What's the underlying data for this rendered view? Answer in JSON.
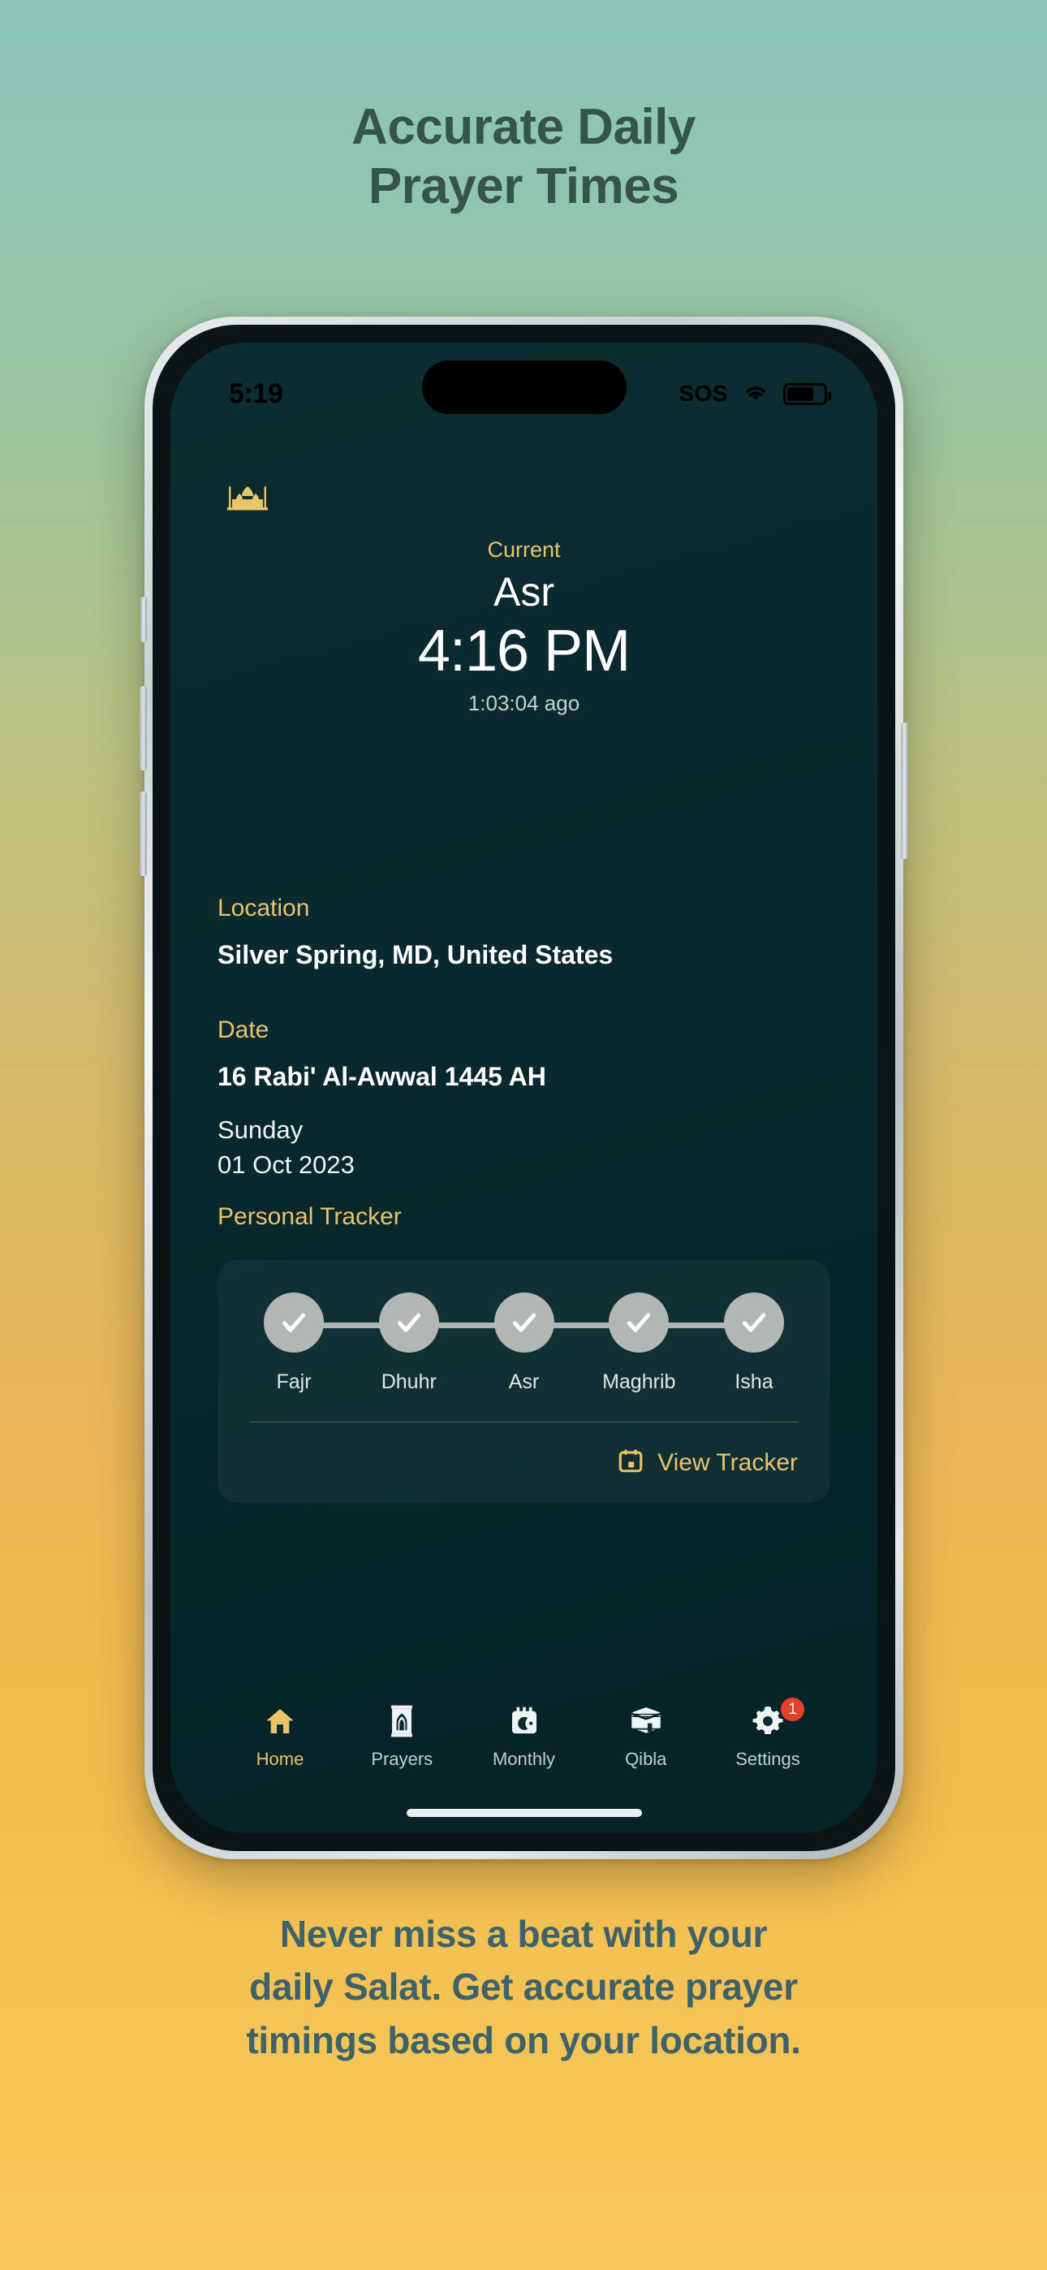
{
  "headline": {
    "line1": "Accurate Daily",
    "line2": "Prayer Times"
  },
  "status_bar": {
    "time": "5:19",
    "sos": "SOS",
    "wifi_icon": "wifi-icon",
    "battery_icon": "battery-icon",
    "battery_level_percent": 72
  },
  "app": {
    "logo_icon": "mosque-logo-icon",
    "current": {
      "label": "Current",
      "prayer_name": "Asr",
      "time": "4:16 PM",
      "elapsed": "1:03:04 ago"
    },
    "location": {
      "label": "Location",
      "value": "Silver Spring, MD, United States"
    },
    "date": {
      "label": "Date",
      "hijri": "16 Rabi' Al-Awwal 1445 AH",
      "weekday": "Sunday",
      "gregorian": "01 Oct 2023"
    },
    "tracker": {
      "label": "Personal Tracker",
      "prayers": [
        {
          "name": "Fajr",
          "completed": true,
          "icon": "check-icon"
        },
        {
          "name": "Dhuhr",
          "completed": true,
          "icon": "check-icon"
        },
        {
          "name": "Asr",
          "completed": true,
          "icon": "check-icon"
        },
        {
          "name": "Maghrib",
          "completed": true,
          "icon": "check-icon"
        },
        {
          "name": "Isha",
          "completed": true,
          "icon": "check-icon"
        }
      ],
      "view_tracker_label": "View Tracker",
      "view_tracker_icon": "calendar-icon"
    },
    "bottom_nav": [
      {
        "label": "Home",
        "icon": "home-icon",
        "active": true,
        "badge": null
      },
      {
        "label": "Prayers",
        "icon": "prayer-rug-icon",
        "active": false,
        "badge": null
      },
      {
        "label": "Monthly",
        "icon": "calendar-moon-icon",
        "active": false,
        "badge": null
      },
      {
        "label": "Qibla",
        "icon": "kaaba-icon",
        "active": false,
        "badge": null
      },
      {
        "label": "Settings",
        "icon": "gear-icon",
        "active": false,
        "badge": "1"
      }
    ]
  },
  "caption": {
    "line1": "Never miss a beat with your",
    "line2": "daily Salat. Get accurate prayer",
    "line3": "timings based on your location."
  },
  "colors": {
    "gold": "#e9c46a",
    "screen_bg": "#0a2a2f",
    "headline_text": "#36544c",
    "caption_text": "#3d6269",
    "badge_red": "#e8402a",
    "tracker_circle": "#b2b7b4"
  }
}
